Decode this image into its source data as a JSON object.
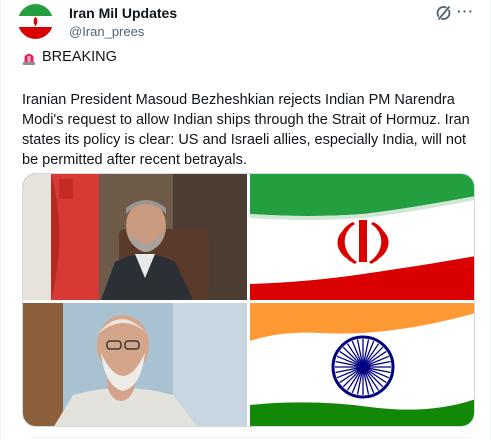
{
  "account": {
    "display_name": "Iran Mil Updates",
    "handle": "@Iran_prees"
  },
  "header_icons": {
    "grok": "grok-icon",
    "more": "more-icon",
    "more_glyph": "···"
  },
  "post": {
    "tag_icon": "siren-icon",
    "tag": "BREAKING",
    "text": "Iranian President Masoud Bezheshkian rejects Indian PM Narendra Modi's request to allow Indian ships through the Strait of Hormuz. Iran states its policy is clear: US and Israeli allies, especially India, will not be permitted after recent betrayals."
  },
  "media": {
    "images": [
      "photo-iranian-president",
      "iran-flag",
      "photo-indian-pm",
      "india-flag"
    ]
  },
  "colors": {
    "text_primary": "#0f1419",
    "text_secondary": "#536471",
    "iran_green": "#239f40",
    "iran_red": "#da0000",
    "india_saffron": "#ff9933",
    "india_green": "#138808",
    "chakra_blue": "#000080"
  }
}
